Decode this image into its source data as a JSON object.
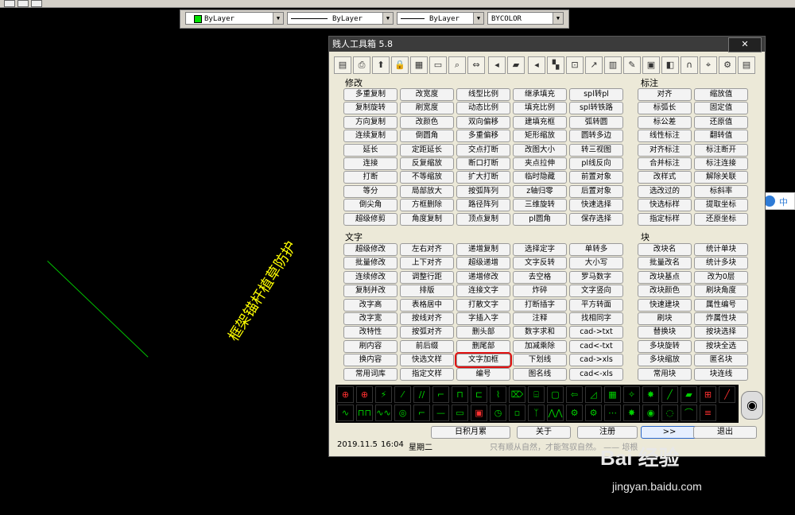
{
  "props": {
    "color": "ByLayer",
    "linetype": "ByLayer",
    "lineweight": "ByLayer",
    "plotstyle": "BYCOLOR"
  },
  "cad": {
    "rotated_text": "框架锚杆植草防护"
  },
  "window": {
    "title": "贱人工具箱 5.8",
    "close": "✕"
  },
  "sections": {
    "modify": "修改",
    "annotate": "标注",
    "text": "文字",
    "block": "块"
  },
  "modify_buttons": [
    [
      "多重复制",
      "改宽度",
      "线型比例",
      "继承填充",
      "spl转pl"
    ],
    [
      "复制旋转",
      "刷宽度",
      "动态比例",
      "填充比例",
      "spl转铁路"
    ],
    [
      "方向复制",
      "改颜色",
      "双向偏移",
      "建填充框",
      "弧转圆"
    ],
    [
      "连续复制",
      "倒圆角",
      "多重偏移",
      "矩形缩放",
      "圆转多边"
    ],
    [
      "延长",
      "定距延长",
      "交点打断",
      "改图大小",
      "转三视图"
    ],
    [
      "连接",
      "反复缩放",
      "断口打断",
      "夹点拉伸",
      "pl线反向"
    ],
    [
      "打断",
      "不等缩放",
      "扩大打断",
      "临时隐藏",
      "前置对象"
    ],
    [
      "等分",
      "局部放大",
      "按弧阵列",
      "z轴归零",
      "后置对象"
    ],
    [
      "倒尖角",
      "方框删除",
      "路径阵列",
      "三维旋转",
      "快速选择"
    ],
    [
      "超级修剪",
      "角度复制",
      "顶点复制",
      "pl圆角",
      "保存选择"
    ]
  ],
  "annotate_buttons": [
    [
      "对齐",
      "缩放值"
    ],
    [
      "标弧长",
      "固定值"
    ],
    [
      "标公差",
      "还原值"
    ],
    [
      "线性标注",
      "翻转值"
    ],
    [
      "对齐标注",
      "标注断开"
    ],
    [
      "合并标注",
      "标注连接"
    ],
    [
      "改样式",
      "解除关联"
    ],
    [
      "选改过的",
      "标斜率"
    ],
    [
      "快选标样",
      "提取坐标"
    ],
    [
      "指定标样",
      "还原坐标"
    ]
  ],
  "text_buttons": [
    [
      "超级修改",
      "左右对齐",
      "递增复制",
      "选择定字",
      "单转多"
    ],
    [
      "批量修改",
      "上下对齐",
      "超级递增",
      "文字反转",
      "大小写"
    ],
    [
      "连续修改",
      "调整行距",
      "递增修改",
      "去空格",
      "罗马数字"
    ],
    [
      "复制并改",
      "排版",
      "连接文字",
      "炸碎",
      "文字竖向"
    ],
    [
      "改字高",
      "表格居中",
      "打散文字",
      "打断插字",
      "平方转面"
    ],
    [
      "改字宽",
      "按线对齐",
      "字插入字",
      "注释",
      "找相同字"
    ],
    [
      "改特性",
      "按弧对齐",
      "删头部",
      "数字求和",
      "cad->txt"
    ],
    [
      "刷内容",
      "前后缀",
      "删尾部",
      "加减乘除",
      "cad<-txt"
    ],
    [
      "换内容",
      "快选文样",
      "文字加框",
      "下划线",
      "cad->xls"
    ],
    [
      "常用词库",
      "指定文样",
      "编号",
      "图名线",
      "cad<-xls"
    ]
  ],
  "block_buttons": [
    [
      "改块名",
      "统计单块"
    ],
    [
      "批量改名",
      "统计多块"
    ],
    [
      "改块基点",
      "改为0层"
    ],
    [
      "改块颜色",
      "刷块角度"
    ],
    [
      "快速建块",
      "属性编号"
    ],
    [
      "刷块",
      "炸属性块"
    ],
    [
      "替换块",
      "按块选择"
    ],
    [
      "多块旋转",
      "按块全选"
    ],
    [
      "多块缩放",
      "匿名块"
    ],
    [
      "常用块",
      "块连线"
    ]
  ],
  "highlighted_button": "文字加框",
  "bottom_buttons": {
    "accumulate": "日积月累",
    "about": "关于",
    "register": "注册",
    "more": ">>",
    "exit": "退出"
  },
  "status": {
    "date": "2019.11.5",
    "time": "16:04",
    "weekday": "星期二",
    "motto": "只有顺从自然，才能驾驭自然。 —— 培根"
  },
  "side_widget": {
    "label": "中"
  },
  "watermark": {
    "brand": "Bai 经验",
    "url": "jingyan.baidu.com"
  },
  "colors": {
    "highlight": "#e01010",
    "cad_text": "#ffff00",
    "cad_line": "#00c000"
  }
}
